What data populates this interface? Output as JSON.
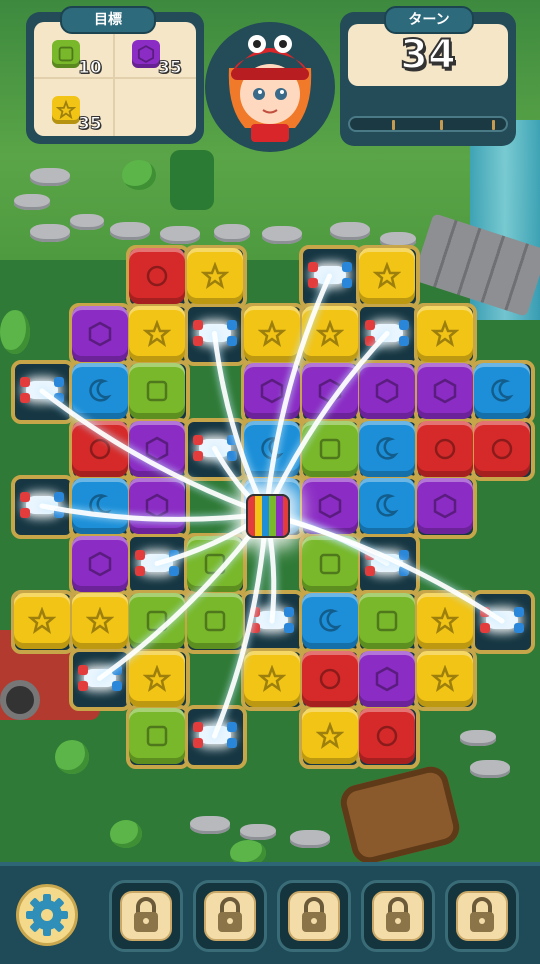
{
  "hud": {
    "goal_label": "目標",
    "turn_label": "ターン",
    "turns_left": "34",
    "progress_fraction": 0.0,
    "goals": [
      {
        "block": "green-square-cube",
        "count": "10",
        "color": "#78b82a"
      },
      {
        "block": "purple-hexagon-cube",
        "count": "35",
        "color": "#8b2cc4"
      },
      {
        "block": "yellow-star-cube",
        "count": "35",
        "color": "#f2c416"
      }
    ],
    "character": "girl-with-red-hat-avatar"
  },
  "board": {
    "columns": 9,
    "rows": 9,
    "legend": {
      "R": "red-circle-cube",
      "Y": "yellow-star-cube",
      "P": "purple-hexagon-cube",
      "B": "blue-moon-cube",
      "G": "green-square-cube",
      "K": "rocket-booster",
      ".": "empty"
    },
    "grid": [
      "..RY.KY..",
      ".PYKYYKY.",
      "KBG.PPPPB",
      ".RPKBGBRR",
      "KBP.BPBP.",
      ".PKG.GK..",
      "YYGGKBGYK",
      ".KY.YRPY.",
      "..GK.YR.."
    ],
    "special_center": "disco-ball-booster"
  },
  "bottom_bar": {
    "settings": "gear-icon",
    "slots": [
      "locked",
      "locked",
      "locked",
      "locked",
      "locked"
    ]
  },
  "colors": {
    "red": "#d62a2a",
    "yellow": "#f2c416",
    "purple": "#8b2cc4",
    "blue": "#1c8fd8",
    "green": "#78b82a",
    "panel": "#234b58",
    "panel_fill": "#f6e6c8"
  }
}
